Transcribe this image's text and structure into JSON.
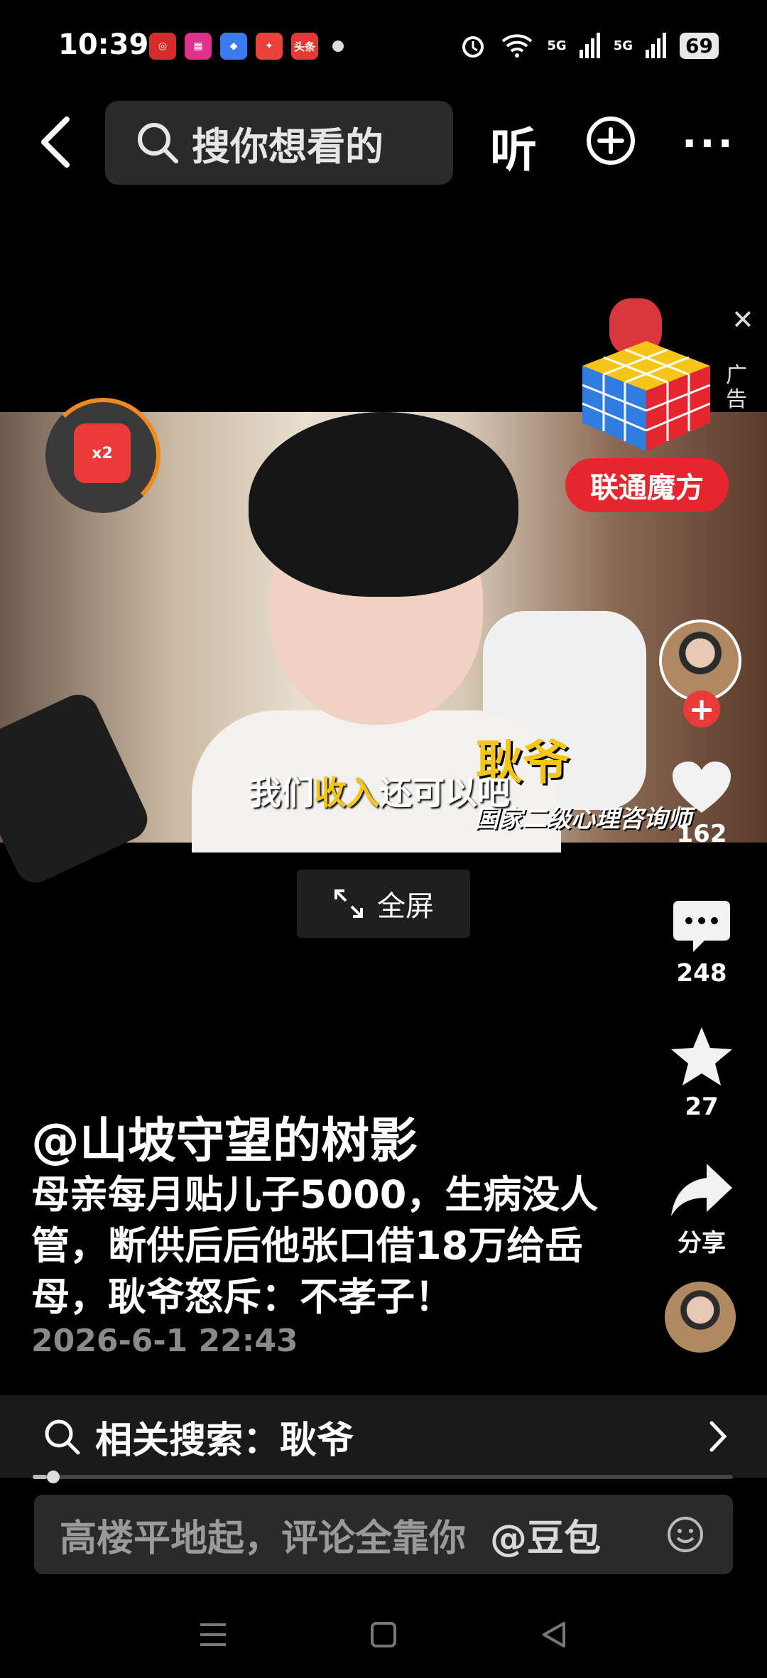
{
  "status_bar": {
    "time": "10:39",
    "apps": [
      "bank-app-icon",
      "shop-app-icon",
      "browser-app-icon",
      "game-app-icon",
      "toutiao-app-icon"
    ],
    "app_labels": {
      "toutiao": "头条"
    },
    "network_1": "5G",
    "network_2": "5G",
    "battery": "69"
  },
  "top_bar": {
    "search_placeholder": "搜你想看的",
    "listen_label": "听"
  },
  "video": {
    "subtitle_part1": "我们",
    "subtitle_highlight": "收入",
    "subtitle_part2": "还可以吧",
    "name_overlay": "耿爷",
    "title_overlay": "国家二级心理咨询师",
    "redpack_label": "x2",
    "fullscreen_label": "全屏"
  },
  "ad": {
    "tag": "广告",
    "button_label": "联通魔方"
  },
  "right_rail": {
    "like_count": "162",
    "comment_count": "248",
    "favorite_count": "27",
    "share_label": "分享"
  },
  "caption": {
    "author": "@山坡守望的树影",
    "description": "母亲每月贴儿子5000，生病没人管，断供后后他张口借18万给岳母，耿爷怒斥：不孝子！",
    "date": "2026-6-1 22:43"
  },
  "related_search": {
    "label": "相关搜索：耿爷"
  },
  "playback": {
    "progress": 0.02
  },
  "comment_bar": {
    "placeholder": "高楼平地起，评论全靠你",
    "mention": "@豆包"
  },
  "colors": {
    "accent_red": "#e5262f",
    "highlight_yellow": "#f5c518"
  }
}
